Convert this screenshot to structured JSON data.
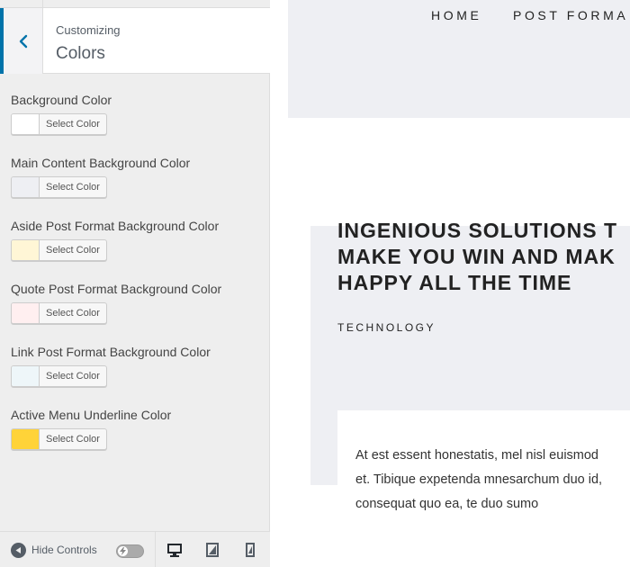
{
  "customizer": {
    "breadcrumb": "Customizing",
    "section_title": "Colors",
    "controls": [
      {
        "label": "Background Color",
        "button": "Select Color",
        "swatch": "#ffffff"
      },
      {
        "label": "Main Content Background Color",
        "button": "Select Color",
        "swatch": "#eeeff3"
      },
      {
        "label": "Aside Post Format Background Color",
        "button": "Select Color",
        "swatch": "#fff6d6"
      },
      {
        "label": "Quote Post Format Background Color",
        "button": "Select Color",
        "swatch": "#ffeff0"
      },
      {
        "label": "Link Post Format Background Color",
        "button": "Select Color",
        "swatch": "#eef6f9"
      },
      {
        "label": "Active Menu Underline Color",
        "button": "Select Color",
        "swatch": "#ffd338"
      }
    ],
    "footer": {
      "hide_controls": "Hide Controls",
      "devices": [
        "desktop-icon",
        "tablet-icon",
        "mobile-icon"
      ]
    }
  },
  "preview": {
    "nav": [
      "HOME",
      "POST FORMA"
    ],
    "post_title_lines": [
      "INGENIOUS SOLUTIONS T",
      "MAKE YOU WIN AND MAK",
      "HAPPY ALL THE TIME"
    ],
    "category": "TECHNOLOGY",
    "excerpt_lines": [
      "At est essent honestatis, mel nisl euismod",
      "et. Tibique expetenda mnesarchum duo id,",
      "consequat quo ea, te duo sumo"
    ]
  },
  "colors": {
    "accent": "#0073aa",
    "content_bg": "#eeeff3"
  }
}
